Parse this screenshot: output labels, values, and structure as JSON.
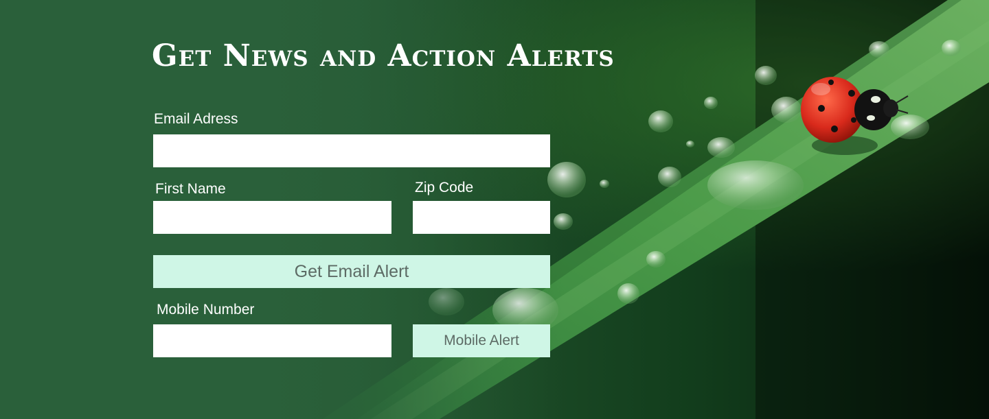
{
  "page": {
    "title": "Get News and Action Alerts"
  },
  "form": {
    "email_label": "Email Adress",
    "email_value": "",
    "first_name_label": "First Name",
    "first_name_value": "",
    "zip_label": "Zip Code",
    "zip_value": "",
    "email_button_label": "Get Email Alert",
    "mobile_label": "Mobile Number",
    "mobile_value": "",
    "mobile_button_label": "Mobile Alert"
  },
  "colors": {
    "background_green": "#2a603a",
    "button_fill": "#cff6e6",
    "button_text": "#5d6b65",
    "field_fill": "#ffffff",
    "ladybug_red": "#d92a1c"
  },
  "background_image": {
    "subject": "ladybug-on-grass-blade-with-dew-drops"
  }
}
